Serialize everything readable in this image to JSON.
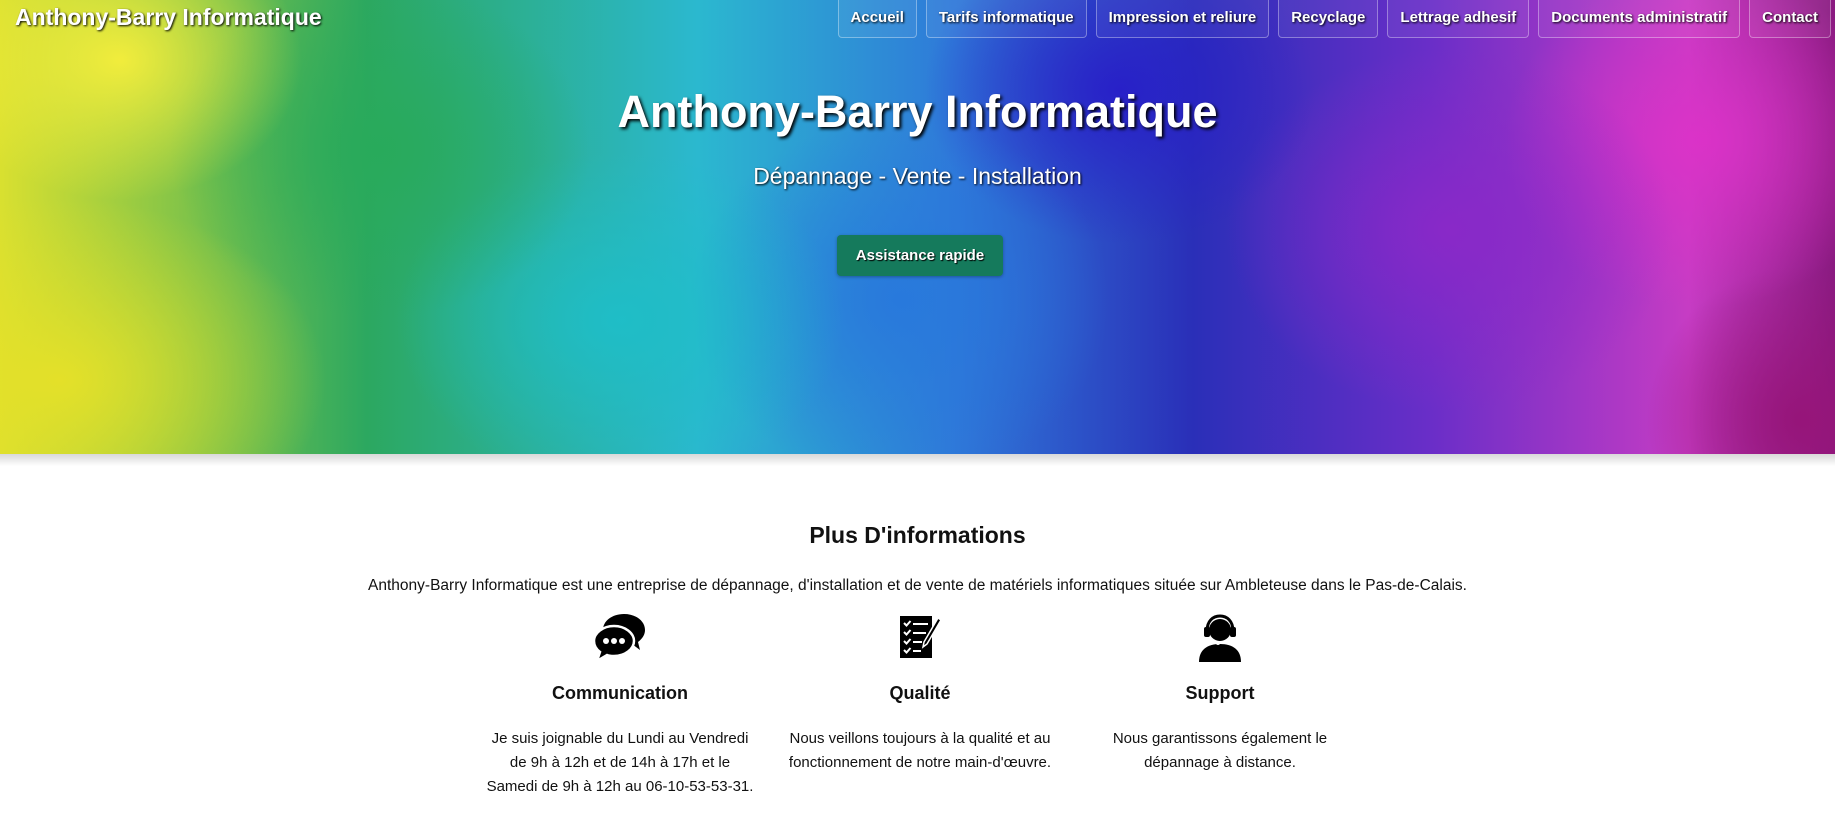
{
  "header": {
    "brand": "Anthony-Barry Informatique",
    "nav": [
      "Accueil",
      "Tarifs informatique",
      "Impression et reliure",
      "Recyclage",
      "Lettrage adhesif",
      "Documents administratif",
      "Contact"
    ]
  },
  "hero": {
    "title": "Anthony-Barry Informatique",
    "subtitle": "Dépannage - Vente - Installation",
    "cta_label": "Assistance rapide",
    "cta_color": "#157a5c"
  },
  "info": {
    "title": "Plus D'informations",
    "intro": "Anthony-Barry Informatique est une entreprise de dépannage, d'installation et de vente de matériels informatiques située sur Ambleteuse dans le Pas-de-Calais.",
    "features": [
      {
        "icon": "chat-bubbles-icon",
        "title": "Communication",
        "text": "Je suis joignable du Lundi au Vendredi de 9h à 12h et de 14h à 17h et le Samedi de 9h à 12h au 06-10-53-53-31."
      },
      {
        "icon": "checklist-icon",
        "title": "Qualité",
        "text": "Nous veillons toujours à la qualité et au fonctionnement de notre main-d'œuvre."
      },
      {
        "icon": "headset-support-icon",
        "title": "Support",
        "text": "Nous garantissons également le dépannage à distance."
      }
    ]
  }
}
